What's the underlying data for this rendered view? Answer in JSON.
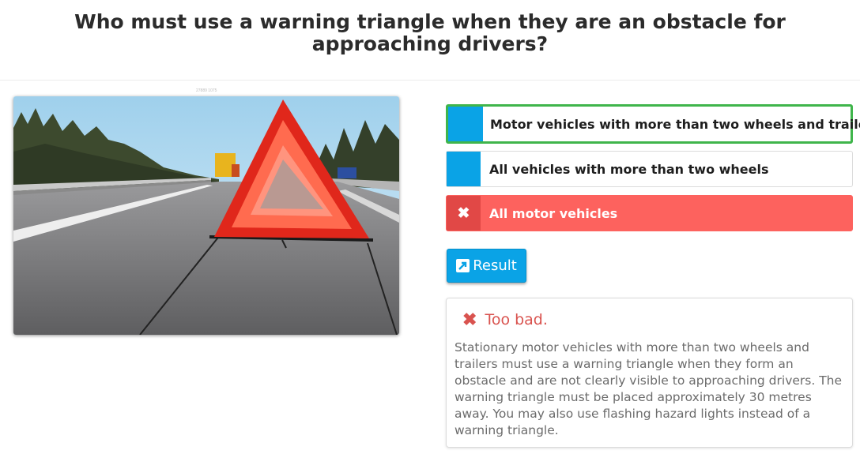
{
  "question": "Who must use a warning triangle when they are an obstacle for approaching drivers?",
  "image_caption": "27889 1075",
  "answers": [
    {
      "label": "Motor vehicles with more than two wheels and trailers",
      "state": "correct"
    },
    {
      "label": "All vehicles with more than two wheels",
      "state": "neutral"
    },
    {
      "label": "All motor vehicles",
      "state": "wrong",
      "marker": "✖"
    }
  ],
  "result_button": {
    "label": "Result",
    "icon": "external-link-icon"
  },
  "feedback": {
    "icon": "✖",
    "title": "Too bad.",
    "text": "Stationary motor vehicles with more than two wheels and trailers must use a warning triangle when they form an obstacle and are not clearly visible to approaching drivers. The warning triangle must be placed approximately 30 metres away. You may also use flashing hazard lights instead of a warning triangle."
  },
  "colors": {
    "accent": "#0aa3e6",
    "correct_border": "#3fb54b",
    "wrong_bg": "#fd625e",
    "wrong_marker": "#e14846",
    "feedback_red": "#d9534f"
  }
}
